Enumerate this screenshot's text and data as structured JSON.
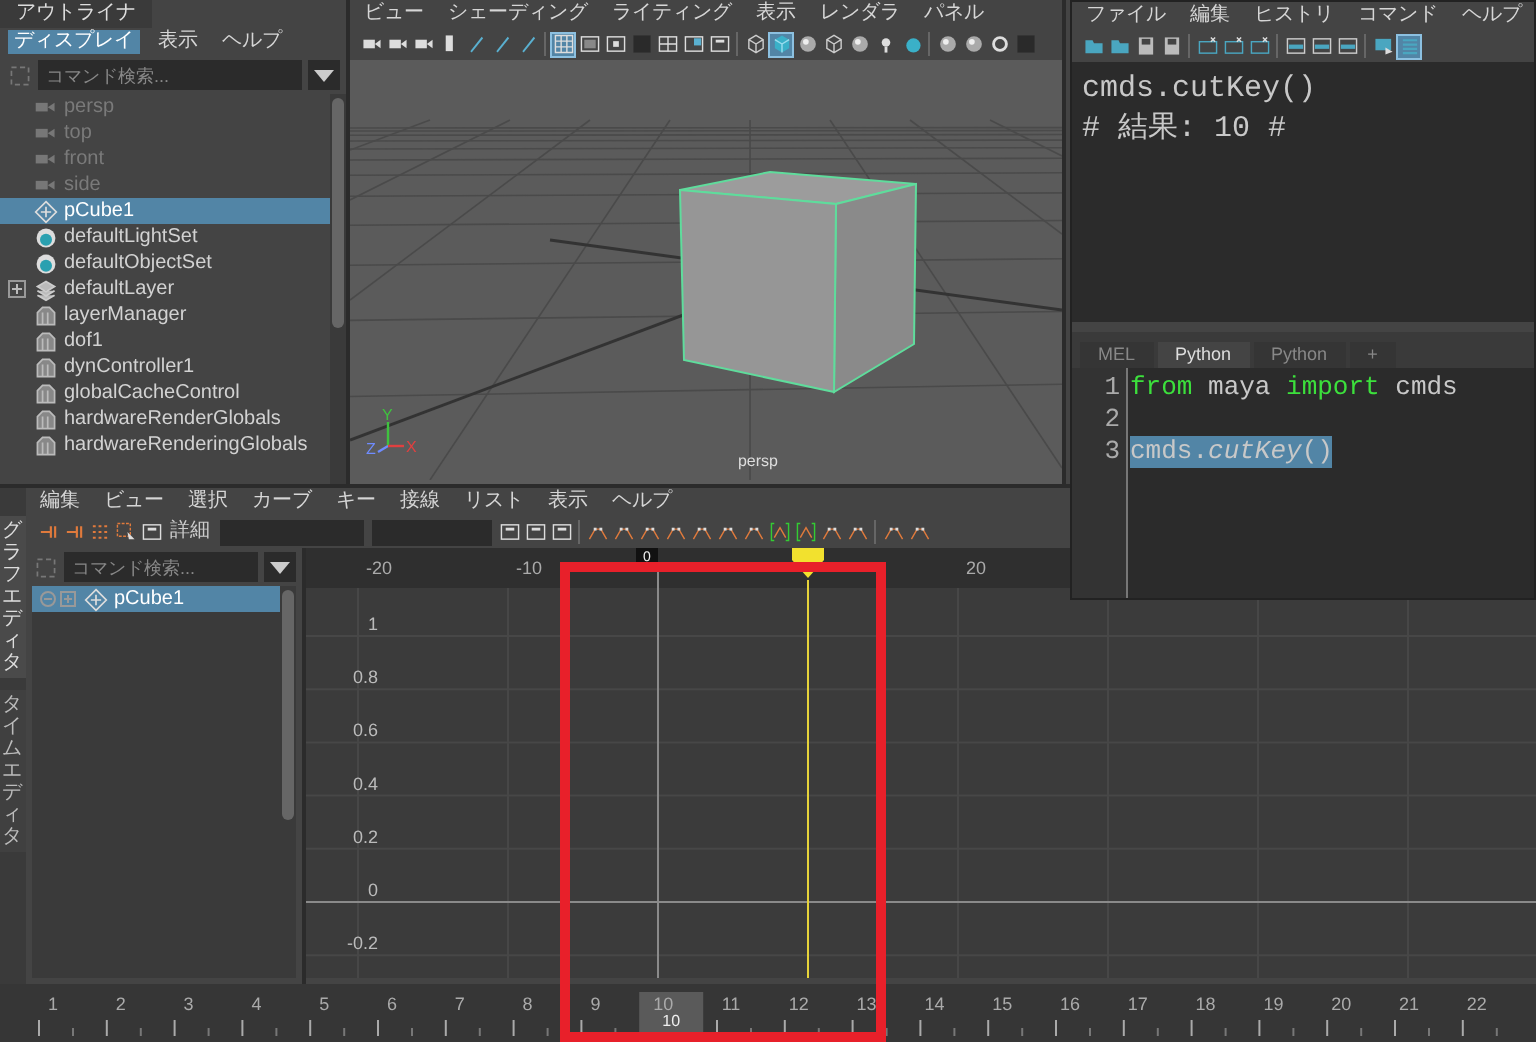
{
  "outliner": {
    "title": "アウトライナ",
    "menus": [
      {
        "label": "ディスプレイ",
        "selected": true
      },
      {
        "label": "表示",
        "selected": false
      },
      {
        "label": "ヘルプ",
        "selected": false
      }
    ],
    "search": {
      "placeholder": "コマンド検索..."
    },
    "items": [
      {
        "label": "persp",
        "kind": "camera",
        "dimmed": true,
        "selected": false,
        "has_children": false
      },
      {
        "label": "top",
        "kind": "camera",
        "dimmed": true,
        "selected": false,
        "has_children": false
      },
      {
        "label": "front",
        "kind": "camera",
        "dimmed": true,
        "selected": false,
        "has_children": false
      },
      {
        "label": "side",
        "kind": "camera",
        "dimmed": true,
        "selected": false,
        "has_children": false
      },
      {
        "label": "pCube1",
        "kind": "transform",
        "dimmed": false,
        "selected": true,
        "has_children": false
      },
      {
        "label": "defaultLightSet",
        "kind": "set",
        "dimmed": false,
        "selected": false,
        "has_children": false
      },
      {
        "label": "defaultObjectSet",
        "kind": "set",
        "dimmed": false,
        "selected": false,
        "has_children": false
      },
      {
        "label": "defaultLayer",
        "kind": "layer",
        "dimmed": false,
        "selected": false,
        "has_children": true
      },
      {
        "label": "layerManager",
        "kind": "node",
        "dimmed": false,
        "selected": false,
        "has_children": false
      },
      {
        "label": "dof1",
        "kind": "node",
        "dimmed": false,
        "selected": false,
        "has_children": false
      },
      {
        "label": "dynController1",
        "kind": "node",
        "dimmed": false,
        "selected": false,
        "has_children": false
      },
      {
        "label": "globalCacheControl",
        "kind": "node",
        "dimmed": false,
        "selected": false,
        "has_children": false
      },
      {
        "label": "hardwareRenderGlobals",
        "kind": "node",
        "dimmed": false,
        "selected": false,
        "has_children": false
      },
      {
        "label": "hardwareRenderingGlobals",
        "kind": "node",
        "dimmed": false,
        "selected": false,
        "has_children": false
      }
    ]
  },
  "viewport": {
    "menus": [
      "ビュー",
      "シェーディング",
      "ライティング",
      "表示",
      "レンダラ",
      "パネル"
    ],
    "toolbar": [
      {
        "kind": "camera",
        "selected": false
      },
      {
        "kind": "camera",
        "selected": false
      },
      {
        "kind": "camera",
        "selected": false
      },
      {
        "kind": "bookmark",
        "selected": false
      },
      {
        "kind": "pencil",
        "selected": false
      },
      {
        "kind": "pencil",
        "selected": false
      },
      {
        "kind": "pencil",
        "selected": false
      },
      {
        "kind": "separator"
      },
      {
        "kind": "grid",
        "selected": true
      },
      {
        "kind": "film",
        "selected": false
      },
      {
        "kind": "square",
        "selected": false
      },
      {
        "kind": "darksquare",
        "selected": false
      },
      {
        "kind": "split",
        "selected": false
      },
      {
        "kind": "image",
        "selected": false
      },
      {
        "kind": "frame",
        "selected": false
      },
      {
        "kind": "separator"
      },
      {
        "kind": "wirecube",
        "selected": false
      },
      {
        "kind": "cube",
        "selected": true
      },
      {
        "kind": "sphere",
        "selected": false
      },
      {
        "kind": "wirecube",
        "selected": false
      },
      {
        "kind": "sphere",
        "selected": false
      },
      {
        "kind": "light",
        "selected": false
      },
      {
        "kind": "dot",
        "selected": false
      },
      {
        "kind": "separator"
      },
      {
        "kind": "sphere",
        "selected": false
      },
      {
        "kind": "sphere",
        "selected": false
      },
      {
        "kind": "ring",
        "selected": false
      },
      {
        "kind": "darksquare",
        "selected": false
      }
    ],
    "camera": "persp",
    "axes": [
      {
        "label": "Y",
        "color": "#3fc23f"
      },
      {
        "label": "Z",
        "color": "#6f8cff"
      },
      {
        "label": "X",
        "color": "#e04040"
      }
    ]
  },
  "script_editor": {
    "menus": [
      "ファイル",
      "編集",
      "ヒストリ",
      "コマンド",
      "ヘルプ"
    ],
    "toolbar": [
      {
        "kind": "folder",
        "selected": false
      },
      {
        "kind": "folder",
        "selected": false
      },
      {
        "kind": "save",
        "selected": false
      },
      {
        "kind": "save",
        "selected": false
      },
      {
        "kind": "separator"
      },
      {
        "kind": "clear",
        "selected": false
      },
      {
        "kind": "clear",
        "selected": false
      },
      {
        "kind": "clear",
        "selected": false
      },
      {
        "kind": "separator"
      },
      {
        "kind": "panel",
        "selected": false
      },
      {
        "kind": "panel",
        "selected": false
      },
      {
        "kind": "panel",
        "selected": false
      },
      {
        "kind": "separator"
      },
      {
        "kind": "run",
        "selected": false
      },
      {
        "kind": "list",
        "selected": true
      }
    ],
    "output": [
      "cmds.cutKey()",
      "# 結果: 10 #"
    ],
    "tabs": [
      {
        "label": "MEL",
        "selected": false
      },
      {
        "label": "Python",
        "selected": true
      },
      {
        "label": "Python",
        "selected": false
      },
      {
        "label": "+",
        "selected": false
      }
    ],
    "lines": [
      {
        "number": "1",
        "selected": false,
        "tokens": [
          {
            "text": "from",
            "kind": "keyword"
          },
          {
            "text": " maya ",
            "kind": "plain"
          },
          {
            "text": "import",
            "kind": "keyword"
          },
          {
            "text": " cmds",
            "kind": "plain"
          }
        ]
      },
      {
        "number": "2",
        "selected": false
      },
      {
        "number": "3",
        "selected": true,
        "tokens": [
          {
            "text": "cmds.",
            "kind": "plain"
          },
          {
            "text": "cutKey",
            "kind": "italic"
          },
          {
            "text": "()",
            "kind": "plain"
          }
        ]
      }
    ]
  },
  "graph_editor": {
    "side_tabs": [
      {
        "label": "グラフエディタ",
        "selected": true
      },
      {
        "label": "タイムエディタ",
        "selected": false
      }
    ],
    "menus": [
      "編集",
      "ビュー",
      "選択",
      "カーブ",
      "キー",
      "接線",
      "リスト",
      "表示",
      "ヘルプ"
    ],
    "toolbar": [
      {
        "kind": "key",
        "selected": false
      },
      {
        "kind": "key",
        "selected": false
      },
      {
        "kind": "lattice",
        "selected": false
      },
      {
        "kind": "select",
        "selected": false
      },
      {
        "kind": "frame",
        "selected": false
      },
      {
        "kind": "label",
        "text": "詳細"
      },
      {
        "kind": "field"
      },
      {
        "kind": "field"
      },
      {
        "kind": "frame",
        "selected": false
      },
      {
        "kind": "frame",
        "selected": false
      },
      {
        "kind": "frame",
        "selected": false
      },
      {
        "kind": "separator"
      },
      {
        "kind": "tangent",
        "selected": false
      },
      {
        "kind": "tangent",
        "selected": false
      },
      {
        "kind": "tangent",
        "selected": false
      },
      {
        "kind": "tangent",
        "selected": false
      },
      {
        "kind": "tangent",
        "selected": false
      },
      {
        "kind": "tangent",
        "selected": false
      },
      {
        "kind": "tangent",
        "selected": false
      },
      {
        "kind": "bracket",
        "selected": false
      },
      {
        "kind": "bracket",
        "selected": false
      },
      {
        "kind": "tangent",
        "selected": false
      },
      {
        "kind": "tangent",
        "selected": false
      },
      {
        "kind": "separator"
      },
      {
        "kind": "tangent",
        "selected": false
      },
      {
        "kind": "tangent",
        "selected": false
      }
    ],
    "search": {
      "placeholder": "コマンド検索..."
    },
    "items": [
      {
        "label": "pCube1",
        "selected": true
      }
    ],
    "x_ticks": [
      "-20",
      "-10",
      "20"
    ],
    "start_marker": "0",
    "y_ticks": [
      "1",
      "0.8",
      "0.6",
      "0.4",
      "0.2",
      "0",
      "-0.2"
    ]
  },
  "time_slider": {
    "frames": [
      {
        "label": "1",
        "selected": false
      },
      {
        "label": "2",
        "selected": false
      },
      {
        "label": "3",
        "selected": false
      },
      {
        "label": "4",
        "selected": false
      },
      {
        "label": "5",
        "selected": false
      },
      {
        "label": "6",
        "selected": false
      },
      {
        "label": "7",
        "selected": false
      },
      {
        "label": "8",
        "selected": false
      },
      {
        "label": "9",
        "selected": false
      },
      {
        "label": "10",
        "selected": true
      },
      {
        "label": "11",
        "selected": false
      },
      {
        "label": "12",
        "selected": false
      },
      {
        "label": "13",
        "selected": false
      },
      {
        "label": "14",
        "selected": false
      },
      {
        "label": "15",
        "selected": false
      },
      {
        "label": "16",
        "selected": false
      },
      {
        "label": "17",
        "selected": false
      },
      {
        "label": "18",
        "selected": false
      },
      {
        "label": "19",
        "selected": false
      },
      {
        "label": "20",
        "selected": false
      },
      {
        "label": "21",
        "selected": false
      },
      {
        "label": "22",
        "selected": false
      }
    ],
    "current_label": "10"
  }
}
